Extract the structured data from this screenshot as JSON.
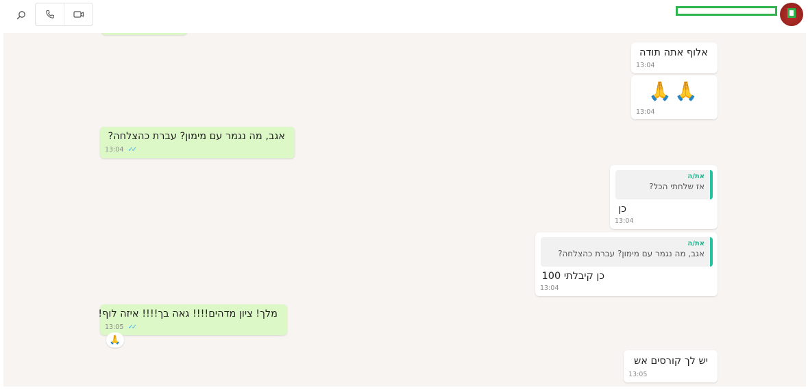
{
  "header": {
    "contact_name": "",
    "icons": {
      "search": "search-icon",
      "voice": "phone-icon",
      "video": "video-camera-icon"
    }
  },
  "messages": [
    {
      "id": "m1",
      "direction": "incoming",
      "text": "אלוף אתה תודה",
      "time": "13:04"
    },
    {
      "id": "m2",
      "direction": "incoming",
      "text": "🙏🙏",
      "time": "13:04"
    },
    {
      "id": "m3",
      "direction": "outgoing",
      "text": "אגב, מה נגמר עם מימון? עברת כהצלחה?",
      "time": "13:04",
      "status": "read"
    },
    {
      "id": "m4",
      "direction": "incoming",
      "quote_author": "את/ה",
      "quote_text": "אז שלחתי הכל?",
      "text": "כן",
      "time": "13:04"
    },
    {
      "id": "m5",
      "direction": "incoming",
      "quote_author": "את/ה",
      "quote_text": "אגב, מה נגמר עם מימון? עברת כהצלחה?",
      "text": "כן קיבלתי 100",
      "time": "13:04"
    },
    {
      "id": "m6",
      "direction": "outgoing",
      "text": "מלך! ציון מדהים!!!! גאה בך!!!! איזה לוף!",
      "time": "13:05",
      "status": "read",
      "reaction": "🙏"
    },
    {
      "id": "m7",
      "direction": "incoming",
      "text": "יש לך קורסים אש",
      "time": "13:05"
    }
  ],
  "colors": {
    "chat_bg": "#f7f4f1",
    "outgoing_bubble": "#dcf8c6",
    "incoming_bubble": "#ffffff",
    "quote_accent": "#25c2a0",
    "read_ticks": "#4fb6ec"
  }
}
